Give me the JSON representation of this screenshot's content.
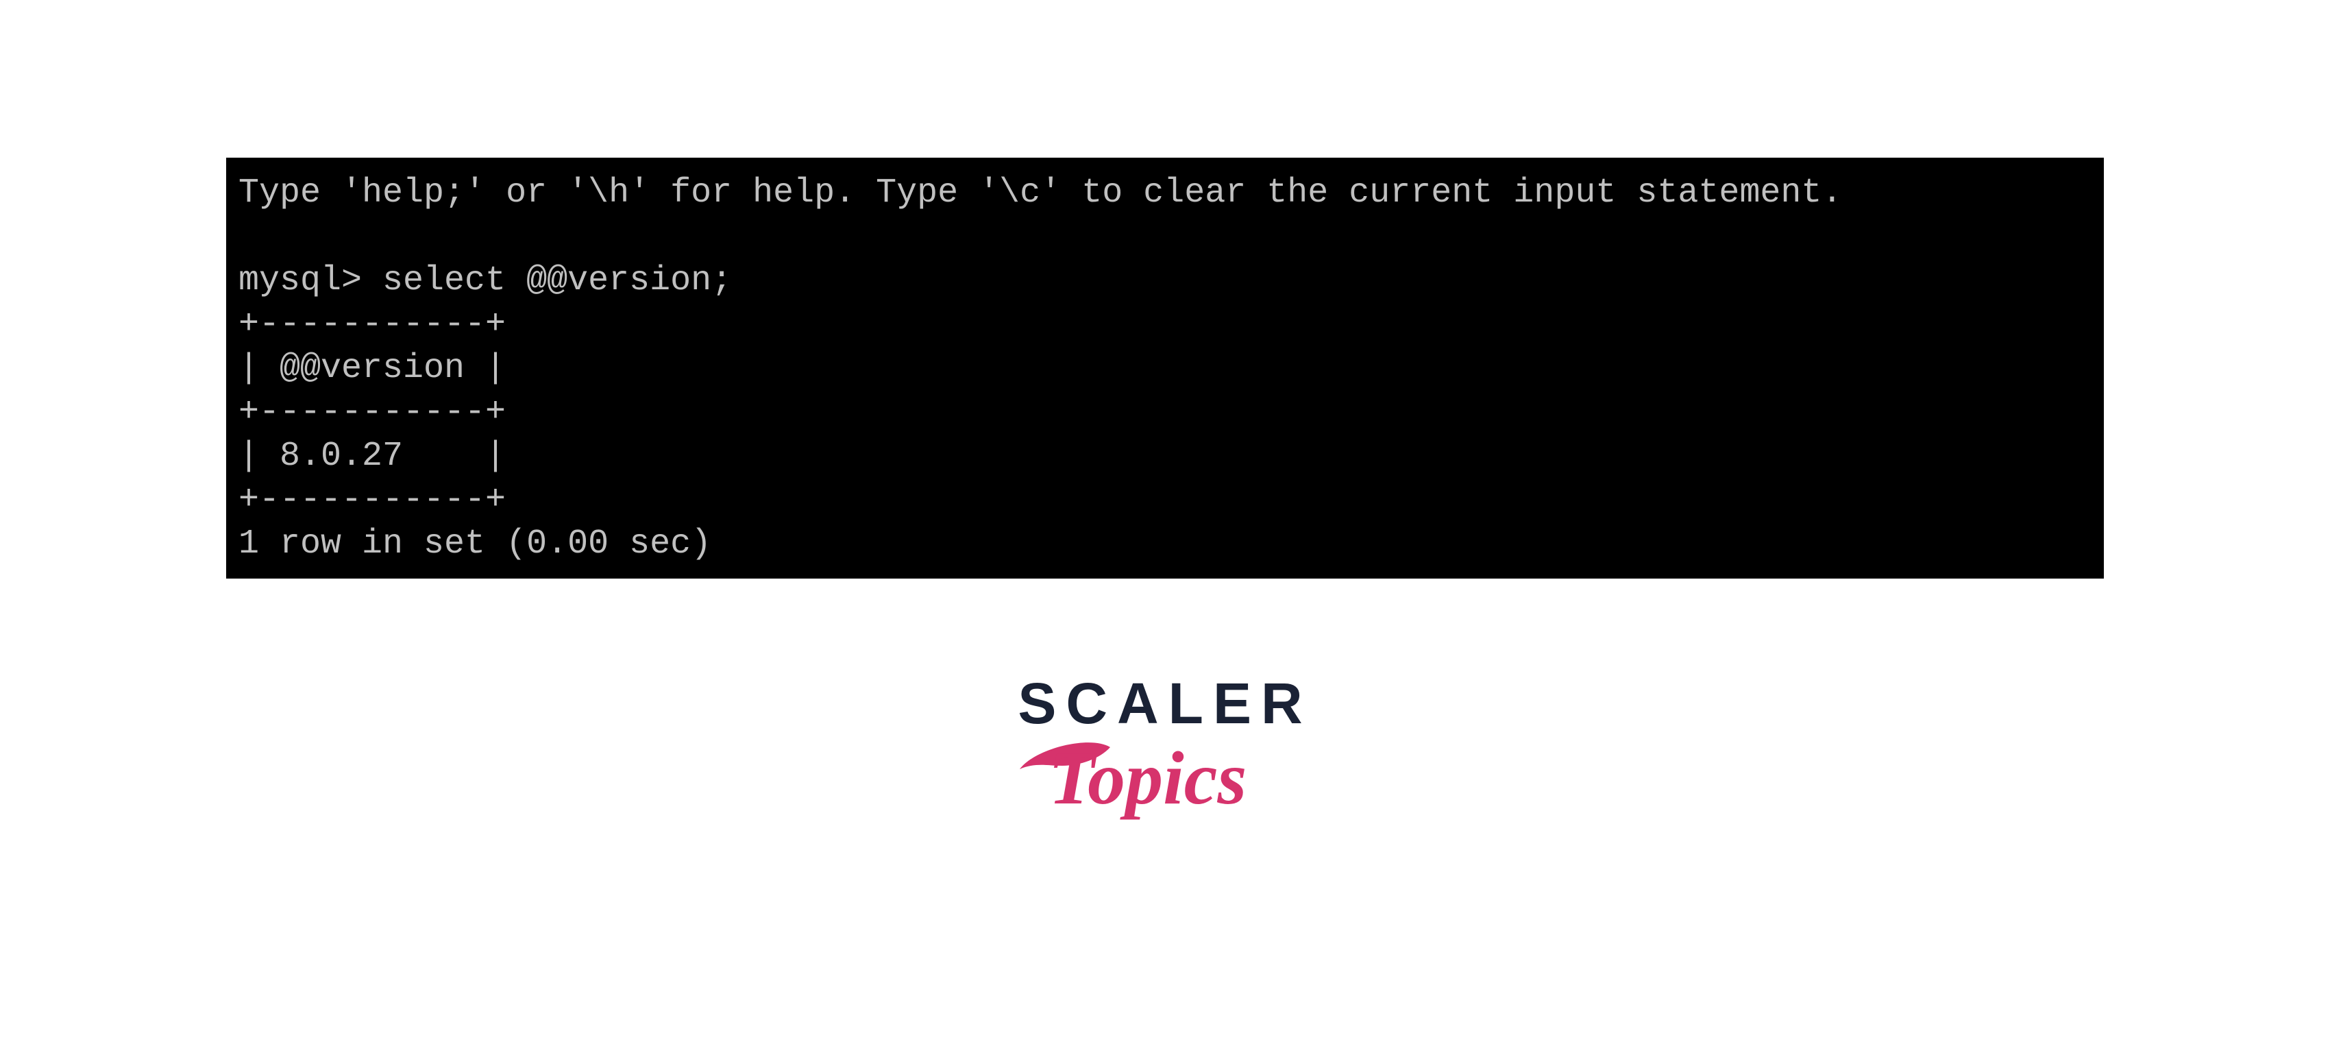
{
  "terminal": {
    "lines": [
      "Type 'help;' or '\\h' for help. Type '\\c' to clear the current input statement.",
      "",
      "mysql> select @@version;",
      "+-----------+",
      "| @@version |",
      "+-----------+",
      "| 8.0.27    |",
      "+-----------+",
      "1 row in set (0.00 sec)"
    ]
  },
  "logo": {
    "scaler": "SCALER",
    "topics": "Topics"
  }
}
